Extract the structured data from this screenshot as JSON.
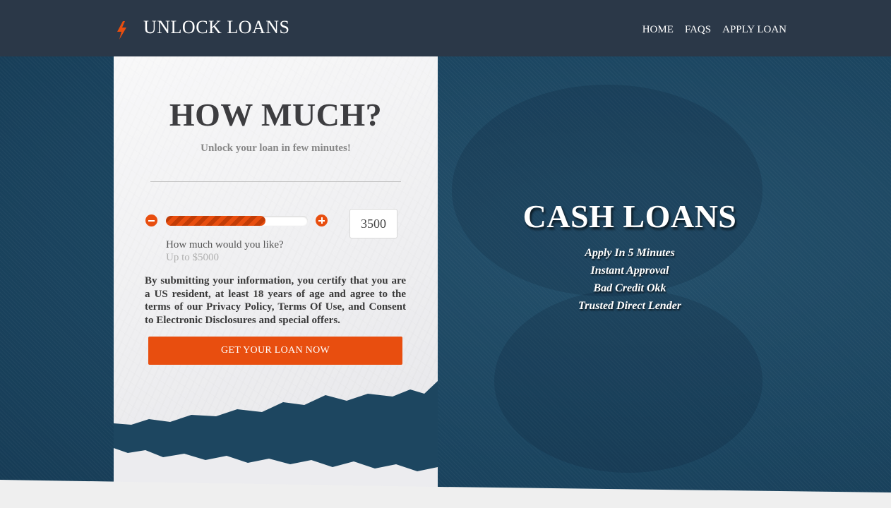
{
  "header": {
    "logo_text": "UNLOCK LOANS",
    "nav": [
      "HOME",
      "FAQS",
      "APPLY LOAN"
    ]
  },
  "form": {
    "title": "HOW MUCH?",
    "subtitle": "Unlock your loan in few minutes!",
    "amount": "3500",
    "slider_fraction": 0.7,
    "question": "How much would you like?",
    "limit": "Up to $5000",
    "disclaimer": "By submitting your information, you certify that you are a US resident, at least 18 years of age and agree to the terms of our Privacy Policy, Terms Of Use, and Consent to Electronic Disclosures and special offers.",
    "submit_label": "GET YOUR LOAN NOW"
  },
  "promo": {
    "title": "CASH LOANS",
    "features": [
      "Apply In 5 Minutes",
      "Instant Approval",
      "Bad Credit Okk",
      "Trusted Direct Lender"
    ]
  },
  "colors": {
    "header_bg": "#2b3848",
    "accent": "#e84e0f",
    "hero_bg": "#1d4660"
  },
  "icons": {
    "logo": "lightning-bolt-icon",
    "decrease": "minus-circle-icon",
    "increase": "plus-circle-icon"
  }
}
